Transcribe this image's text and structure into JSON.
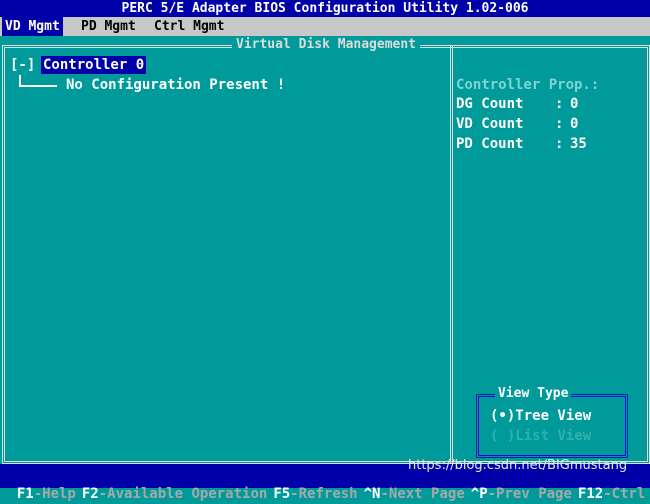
{
  "window": {
    "title": "PERC 5/E Adapter BIOS Configuration Utility 1.02-006"
  },
  "tabs": [
    {
      "label": "VD Mgmt",
      "active": true
    },
    {
      "label": "PD Mgmt",
      "active": false
    },
    {
      "label": "Ctrl Mgmt",
      "active": false
    }
  ],
  "main": {
    "frame_title": "Virtual Disk Management",
    "tree": {
      "toggle": "[-]",
      "controller": "Controller 0",
      "child": "No Configuration Present !"
    }
  },
  "properties": {
    "title": "Controller Prop.:",
    "items": [
      {
        "label": "DG Count",
        "value": "0"
      },
      {
        "label": "VD Count",
        "value": "0"
      },
      {
        "label": "PD Count",
        "value": "35"
      }
    ]
  },
  "view_type": {
    "title": "View Type",
    "options": [
      {
        "label": "(•)Tree View",
        "selected": true
      },
      {
        "label": "( )List View",
        "selected": false
      }
    ]
  },
  "status_bar": [
    {
      "key": "F1",
      "desc": "-Help"
    },
    {
      "key": "F2",
      "desc": "-Available Operation"
    },
    {
      "key": "F5",
      "desc": "-Refresh"
    },
    {
      "key": "^N",
      "desc": "-Next Page"
    },
    {
      "key": "^P",
      "desc": "-Prev Page"
    },
    {
      "key": "F12",
      "desc": "-Ctrl"
    }
  ],
  "watermark": "https://blog.csdn.net/BIGmustang",
  "colors": {
    "background": "#009a9a",
    "highlight": "#0000a8",
    "tabbar": "#c8c8c8"
  }
}
